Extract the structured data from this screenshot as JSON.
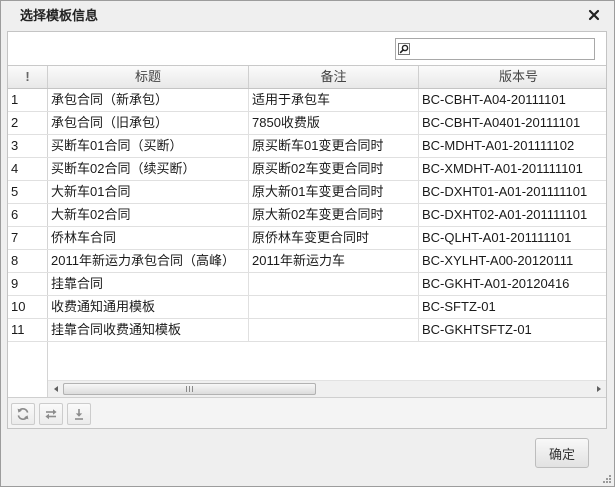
{
  "dialog": {
    "title": "选择模板信息",
    "close_icon": "close-icon",
    "resize_icon": "resize-grip-icon"
  },
  "search": {
    "value": "",
    "icon": "search-icon"
  },
  "grid": {
    "columns": [
      "!",
      "标题",
      "备注",
      "版本号"
    ],
    "rows": [
      {
        "index": "1",
        "title": "承包合同（新承包）",
        "note": "适用于承包车",
        "version": "BC-CBHT-A04-20111101"
      },
      {
        "index": "2",
        "title": "承包合同（旧承包）",
        "note": "7850收费版",
        "version": "BC-CBHT-A0401-20111101"
      },
      {
        "index": "3",
        "title": "买断车01合同（买断）",
        "note": "原买断车01变更合同时",
        "version": "BC-MDHT-A01-201111102"
      },
      {
        "index": "4",
        "title": "买断车02合同（续买断）",
        "note": "原买断02车变更合同时",
        "version": "BC-XMDHT-A01-201111101"
      },
      {
        "index": "5",
        "title": "大新车01合同",
        "note": "原大新01车变更合同时",
        "version": "BC-DXHT01-A01-201111101"
      },
      {
        "index": "6",
        "title": "大新车02合同",
        "note": "原大新02车变更合同时",
        "version": "BC-DXHT02-A01-201111101"
      },
      {
        "index": "7",
        "title": "侨林车合同",
        "note": "原侨林车变更合同时",
        "version": "BC-QLHT-A01-201111101"
      },
      {
        "index": "8",
        "title": "2011年新运力承包合同（高峰）",
        "note": "2011年新运力车",
        "version": "BC-XYLHT-A00-20120111"
      },
      {
        "index": "9",
        "title": "挂靠合同",
        "note": "",
        "version": "BC-GKHT-A01-20120416"
      },
      {
        "index": "10",
        "title": "收费通知通用模板",
        "note": "",
        "version": "BC-SFTZ-01"
      },
      {
        "index": "11",
        "title": "挂靠合同收费通知模板",
        "note": "",
        "version": "BC-GKHTSFTZ-01"
      }
    ],
    "horizontal_scroll": {
      "position_percent": 0,
      "visible_percent": 48
    }
  },
  "toolbar": {
    "buttons": [
      {
        "icon": "refresh-icon"
      },
      {
        "icon": "swap-icon"
      },
      {
        "icon": "download-icon"
      }
    ]
  },
  "footer": {
    "confirm_label": "确定"
  }
}
